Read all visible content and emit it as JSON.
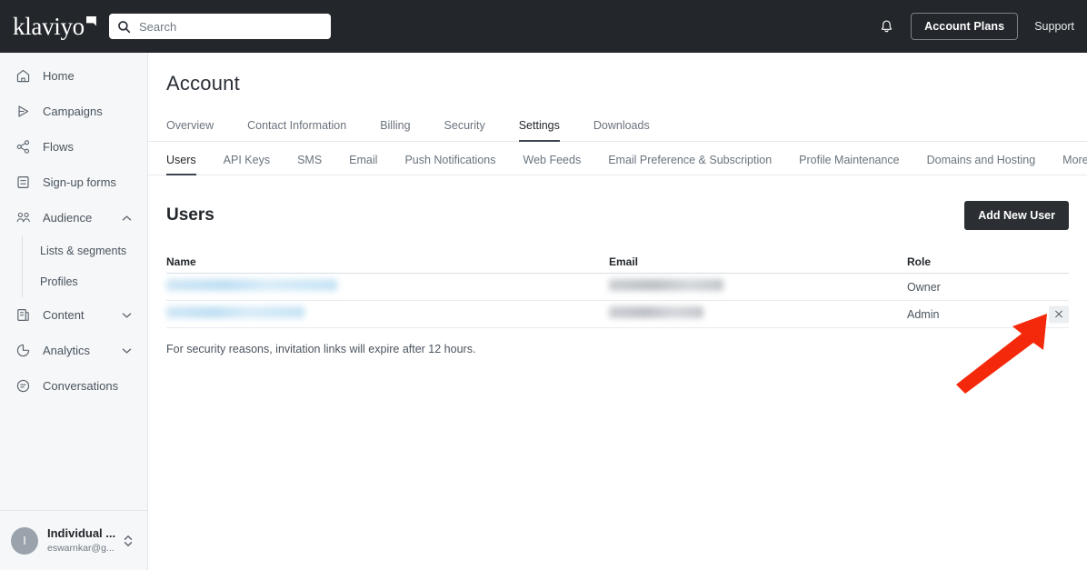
{
  "topbar": {
    "logo_text": "klaviyo",
    "logo_icon": "flag-icon",
    "search": {
      "icon": "search-icon",
      "placeholder": "Search",
      "value": ""
    },
    "notifications_icon": "bell-icon",
    "account_plans_label": "Account Plans",
    "support_label": "Support"
  },
  "sidebar": {
    "items": [
      {
        "label": "Home",
        "icon": "home-icon",
        "expandable": false
      },
      {
        "label": "Campaigns",
        "icon": "send-icon",
        "expandable": false
      },
      {
        "label": "Flows",
        "icon": "flows-icon",
        "expandable": false
      },
      {
        "label": "Sign-up forms",
        "icon": "form-icon",
        "expandable": false
      },
      {
        "label": "Audience",
        "icon": "people-icon",
        "expandable": true,
        "expanded": true
      },
      {
        "label": "Content",
        "icon": "content-icon",
        "expandable": true,
        "expanded": false
      },
      {
        "label": "Analytics",
        "icon": "analytics-icon",
        "expandable": true,
        "expanded": false
      },
      {
        "label": "Conversations",
        "icon": "conversations-icon",
        "expandable": false
      }
    ],
    "audience_children": [
      {
        "label": "Lists & segments"
      },
      {
        "label": "Profiles"
      }
    ],
    "footer": {
      "avatar_initial": "I",
      "account_name": "Individual ...",
      "account_email": "eswarnkar@g...",
      "chevron_icon": "chevron-updown-icon"
    }
  },
  "main": {
    "page_title": "Account",
    "primary_tabs": [
      {
        "label": "Overview",
        "active": false
      },
      {
        "label": "Contact Information",
        "active": false
      },
      {
        "label": "Billing",
        "active": false
      },
      {
        "label": "Security",
        "active": false
      },
      {
        "label": "Settings",
        "active": true
      },
      {
        "label": "Downloads",
        "active": false
      }
    ],
    "secondary_tabs": [
      {
        "label": "Users",
        "active": true
      },
      {
        "label": "API Keys",
        "active": false
      },
      {
        "label": "SMS",
        "active": false
      },
      {
        "label": "Email",
        "active": false
      },
      {
        "label": "Push Notifications",
        "active": false
      },
      {
        "label": "Web Feeds",
        "active": false
      },
      {
        "label": "Email Preference & Subscription",
        "active": false
      },
      {
        "label": "Profile Maintenance",
        "active": false
      },
      {
        "label": "Domains and Hosting",
        "active": false
      }
    ],
    "more_tab_label": "More",
    "more_tab_icon": "chevron-down-icon",
    "section_title": "Users",
    "add_user_label": "Add New User",
    "table": {
      "columns": [
        "Name",
        "Email",
        "Role"
      ],
      "rows": [
        {
          "name": "",
          "name_redacted": true,
          "email": "",
          "email_redacted": true,
          "role": "Owner",
          "removable": false
        },
        {
          "name": "",
          "name_redacted": true,
          "email": "",
          "email_redacted": true,
          "role": "Admin",
          "removable": true
        }
      ]
    },
    "remove_user_icon": "close-x-icon",
    "security_note": "For security reasons, invitation links will expire after 12 hours."
  },
  "annotation": {
    "arrow_icon": "red-arrow-icon",
    "color": "#f4290c",
    "points_to": "remove-user-button"
  },
  "colors": {
    "topbar_bg": "#23272b",
    "sidebar_bg": "#f5f7f8",
    "accent_dark": "#2b2f33",
    "text_primary": "#23272b",
    "text_muted": "#6a737d",
    "annotation_red": "#f4290c"
  }
}
